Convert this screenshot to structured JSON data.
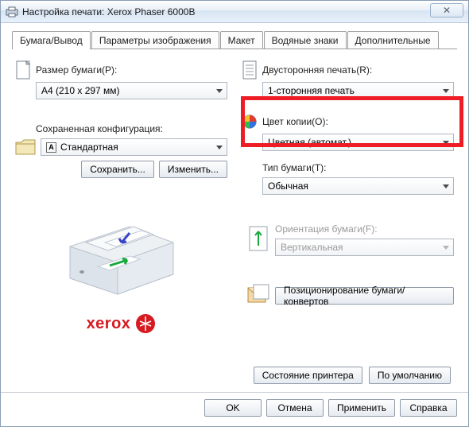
{
  "window": {
    "title": "Настройка печати: Xerox Phaser 6000B"
  },
  "tabs": [
    "Бумага/Вывод",
    "Параметры изображения",
    "Макет",
    "Водяные знаки",
    "Дополнительные"
  ],
  "left": {
    "paperSizeLabel": "Размер бумаги(P):",
    "paperSizeValue": "A4 (210 x 297 мм)",
    "savedCfgLabel": "Сохраненная конфигурация:",
    "savedCfgValue": "Стандартная",
    "saveBtn": "Сохранить...",
    "editBtn": "Изменить..."
  },
  "right": {
    "duplexLabel": "Двусторонняя печать(R):",
    "duplexValue": "1-сторонняя печать",
    "colorLabel": "Цвет копии(O):",
    "colorValue": "Цветная (автомат.)",
    "paperTypeLabel": "Тип бумаги(T):",
    "paperTypeValue": "Обычная",
    "orientLabel": "Ориентация бумаги(F):",
    "orientValue": "Вертикальная",
    "posBtn": "Позиционирование бумаги/конвертов"
  },
  "preBtns": {
    "status": "Состояние принтера",
    "defaults": "По умолчанию"
  },
  "final": {
    "ok": "OK",
    "cancel": "Отмена",
    "apply": "Применить",
    "help": "Справка"
  },
  "logo": "xerox"
}
